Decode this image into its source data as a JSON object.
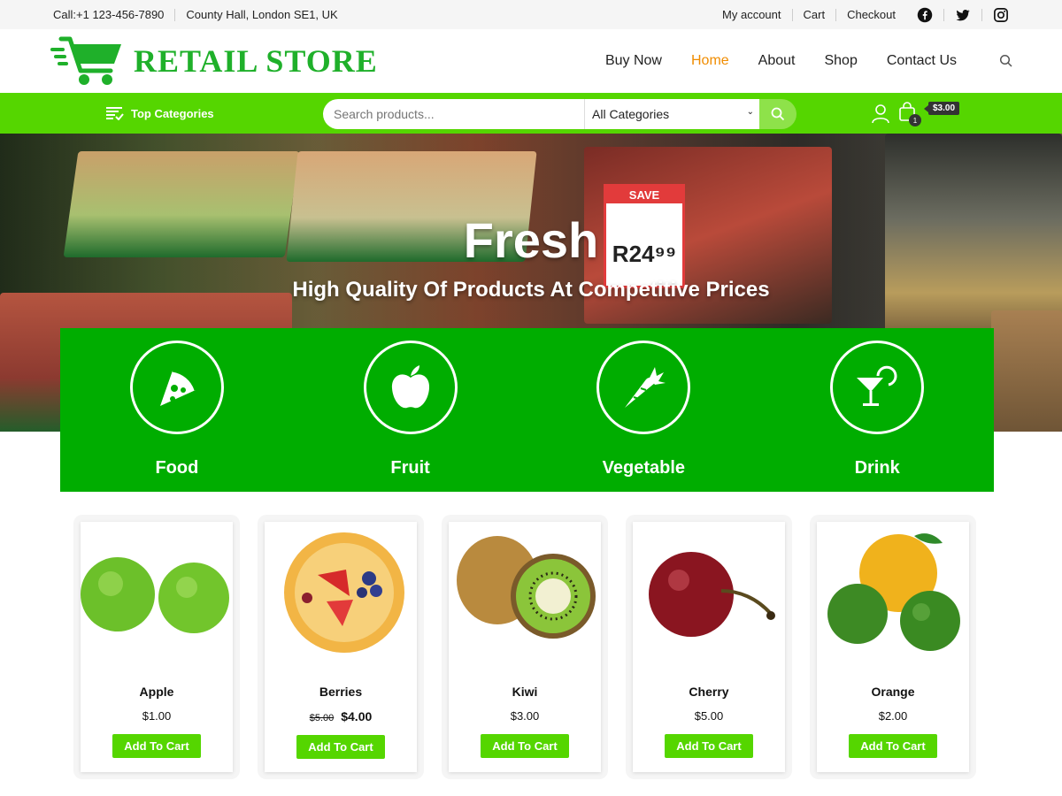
{
  "topbar": {
    "phone": "Call:+1 123-456-7890",
    "address": "County Hall, London SE1, UK",
    "links": [
      "My account",
      "Cart",
      "Checkout"
    ],
    "social": [
      "facebook-icon",
      "twitter-icon",
      "instagram-icon"
    ]
  },
  "header": {
    "logo_text": "RETAIL STORE",
    "nav": [
      {
        "label": "Buy Now",
        "active": false
      },
      {
        "label": "Home",
        "active": true
      },
      {
        "label": "About",
        "active": false
      },
      {
        "label": "Shop",
        "active": false
      },
      {
        "label": "Contact Us",
        "active": false
      }
    ]
  },
  "bar": {
    "top_categories": "Top Categories",
    "search_placeholder": "Search products...",
    "category_select": "All Categories",
    "cart_count": "1",
    "cart_total": "$3.00"
  },
  "hero": {
    "title": "Fresh",
    "subtitle": "High Quality Of Products At Competitive Prices",
    "sign_save": "SAVE",
    "sign_price": "R24⁹⁹"
  },
  "categories": [
    {
      "label": "Food",
      "icon": "pizza-icon"
    },
    {
      "label": "Fruit",
      "icon": "apple-icon"
    },
    {
      "label": "Vegetable",
      "icon": "carrot-icon"
    },
    {
      "label": "Drink",
      "icon": "cocktail-icon"
    }
  ],
  "products": [
    {
      "name": "Apple",
      "price": "$1.00",
      "old_price": "",
      "button": "Add To Cart"
    },
    {
      "name": "Berries",
      "price": "$4.00",
      "old_price": "$5.00",
      "button": "Add To Cart"
    },
    {
      "name": "Kiwi",
      "price": "$3.00",
      "old_price": "",
      "button": "Add To Cart"
    },
    {
      "name": "Cherry",
      "price": "$5.00",
      "old_price": "",
      "button": "Add To Cart"
    },
    {
      "name": "Orange",
      "price": "$2.00",
      "old_price": "",
      "button": "Add To Cart"
    }
  ],
  "colors": {
    "brand_green": "#1fb02a",
    "bar_green": "#55d600",
    "category_green": "#00ad00",
    "active_nav": "#f08c00"
  }
}
